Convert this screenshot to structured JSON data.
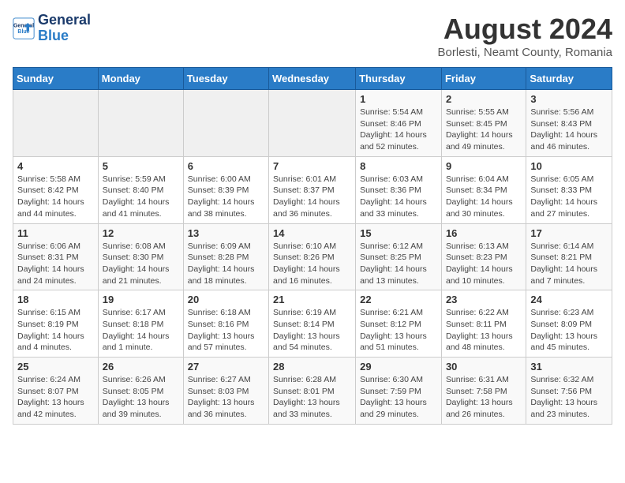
{
  "logo": {
    "line1": "General",
    "line2": "Blue"
  },
  "title": "August 2024",
  "subtitle": "Borlesti, Neamt County, Romania",
  "days_header": [
    "Sunday",
    "Monday",
    "Tuesday",
    "Wednesday",
    "Thursday",
    "Friday",
    "Saturday"
  ],
  "weeks": [
    [
      {
        "day": "",
        "info": ""
      },
      {
        "day": "",
        "info": ""
      },
      {
        "day": "",
        "info": ""
      },
      {
        "day": "",
        "info": ""
      },
      {
        "day": "1",
        "info": "Sunrise: 5:54 AM\nSunset: 8:46 PM\nDaylight: 14 hours\nand 52 minutes."
      },
      {
        "day": "2",
        "info": "Sunrise: 5:55 AM\nSunset: 8:45 PM\nDaylight: 14 hours\nand 49 minutes."
      },
      {
        "day": "3",
        "info": "Sunrise: 5:56 AM\nSunset: 8:43 PM\nDaylight: 14 hours\nand 46 minutes."
      }
    ],
    [
      {
        "day": "4",
        "info": "Sunrise: 5:58 AM\nSunset: 8:42 PM\nDaylight: 14 hours\nand 44 minutes."
      },
      {
        "day": "5",
        "info": "Sunrise: 5:59 AM\nSunset: 8:40 PM\nDaylight: 14 hours\nand 41 minutes."
      },
      {
        "day": "6",
        "info": "Sunrise: 6:00 AM\nSunset: 8:39 PM\nDaylight: 14 hours\nand 38 minutes."
      },
      {
        "day": "7",
        "info": "Sunrise: 6:01 AM\nSunset: 8:37 PM\nDaylight: 14 hours\nand 36 minutes."
      },
      {
        "day": "8",
        "info": "Sunrise: 6:03 AM\nSunset: 8:36 PM\nDaylight: 14 hours\nand 33 minutes."
      },
      {
        "day": "9",
        "info": "Sunrise: 6:04 AM\nSunset: 8:34 PM\nDaylight: 14 hours\nand 30 minutes."
      },
      {
        "day": "10",
        "info": "Sunrise: 6:05 AM\nSunset: 8:33 PM\nDaylight: 14 hours\nand 27 minutes."
      }
    ],
    [
      {
        "day": "11",
        "info": "Sunrise: 6:06 AM\nSunset: 8:31 PM\nDaylight: 14 hours\nand 24 minutes."
      },
      {
        "day": "12",
        "info": "Sunrise: 6:08 AM\nSunset: 8:30 PM\nDaylight: 14 hours\nand 21 minutes."
      },
      {
        "day": "13",
        "info": "Sunrise: 6:09 AM\nSunset: 8:28 PM\nDaylight: 14 hours\nand 18 minutes."
      },
      {
        "day": "14",
        "info": "Sunrise: 6:10 AM\nSunset: 8:26 PM\nDaylight: 14 hours\nand 16 minutes."
      },
      {
        "day": "15",
        "info": "Sunrise: 6:12 AM\nSunset: 8:25 PM\nDaylight: 14 hours\nand 13 minutes."
      },
      {
        "day": "16",
        "info": "Sunrise: 6:13 AM\nSunset: 8:23 PM\nDaylight: 14 hours\nand 10 minutes."
      },
      {
        "day": "17",
        "info": "Sunrise: 6:14 AM\nSunset: 8:21 PM\nDaylight: 14 hours\nand 7 minutes."
      }
    ],
    [
      {
        "day": "18",
        "info": "Sunrise: 6:15 AM\nSunset: 8:19 PM\nDaylight: 14 hours\nand 4 minutes."
      },
      {
        "day": "19",
        "info": "Sunrise: 6:17 AM\nSunset: 8:18 PM\nDaylight: 14 hours\nand 1 minute."
      },
      {
        "day": "20",
        "info": "Sunrise: 6:18 AM\nSunset: 8:16 PM\nDaylight: 13 hours\nand 57 minutes."
      },
      {
        "day": "21",
        "info": "Sunrise: 6:19 AM\nSunset: 8:14 PM\nDaylight: 13 hours\nand 54 minutes."
      },
      {
        "day": "22",
        "info": "Sunrise: 6:21 AM\nSunset: 8:12 PM\nDaylight: 13 hours\nand 51 minutes."
      },
      {
        "day": "23",
        "info": "Sunrise: 6:22 AM\nSunset: 8:11 PM\nDaylight: 13 hours\nand 48 minutes."
      },
      {
        "day": "24",
        "info": "Sunrise: 6:23 AM\nSunset: 8:09 PM\nDaylight: 13 hours\nand 45 minutes."
      }
    ],
    [
      {
        "day": "25",
        "info": "Sunrise: 6:24 AM\nSunset: 8:07 PM\nDaylight: 13 hours\nand 42 minutes."
      },
      {
        "day": "26",
        "info": "Sunrise: 6:26 AM\nSunset: 8:05 PM\nDaylight: 13 hours\nand 39 minutes."
      },
      {
        "day": "27",
        "info": "Sunrise: 6:27 AM\nSunset: 8:03 PM\nDaylight: 13 hours\nand 36 minutes."
      },
      {
        "day": "28",
        "info": "Sunrise: 6:28 AM\nSunset: 8:01 PM\nDaylight: 13 hours\nand 33 minutes."
      },
      {
        "day": "29",
        "info": "Sunrise: 6:30 AM\nSunset: 7:59 PM\nDaylight: 13 hours\nand 29 minutes."
      },
      {
        "day": "30",
        "info": "Sunrise: 6:31 AM\nSunset: 7:58 PM\nDaylight: 13 hours\nand 26 minutes."
      },
      {
        "day": "31",
        "info": "Sunrise: 6:32 AM\nSunset: 7:56 PM\nDaylight: 13 hours\nand 23 minutes."
      }
    ]
  ]
}
